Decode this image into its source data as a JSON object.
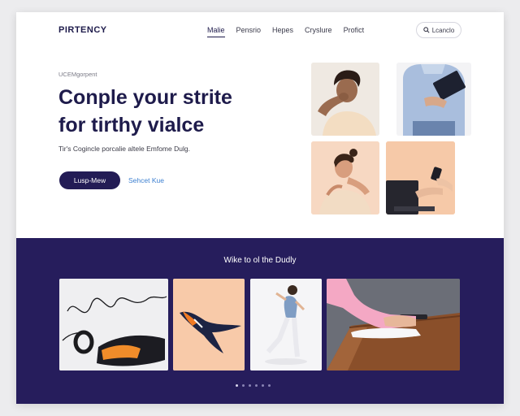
{
  "header": {
    "logo": "PIRTENCY",
    "nav": [
      "Malie",
      "Pensrio",
      "Hepes",
      "Cryslure",
      "Profict"
    ],
    "search_label": "Lcanclo"
  },
  "hero": {
    "eyebrow": "UCEMgorpent",
    "title_line1": "Conple your strite",
    "title_line2": "for tirthy vialce",
    "subtitle": "Tir's Cogincle porcalie altele Emfome Dulg.",
    "primary_button": "Lusp-Mew",
    "secondary_link": "Sehcet Kue"
  },
  "gallery": {
    "title": "Wike to ol the Dudly",
    "active_dot": 0,
    "dot_count": 6
  },
  "colors": {
    "navy": "#261d5c",
    "accent_blue": "#3b7fd0",
    "peach": "#f6c9a8"
  }
}
